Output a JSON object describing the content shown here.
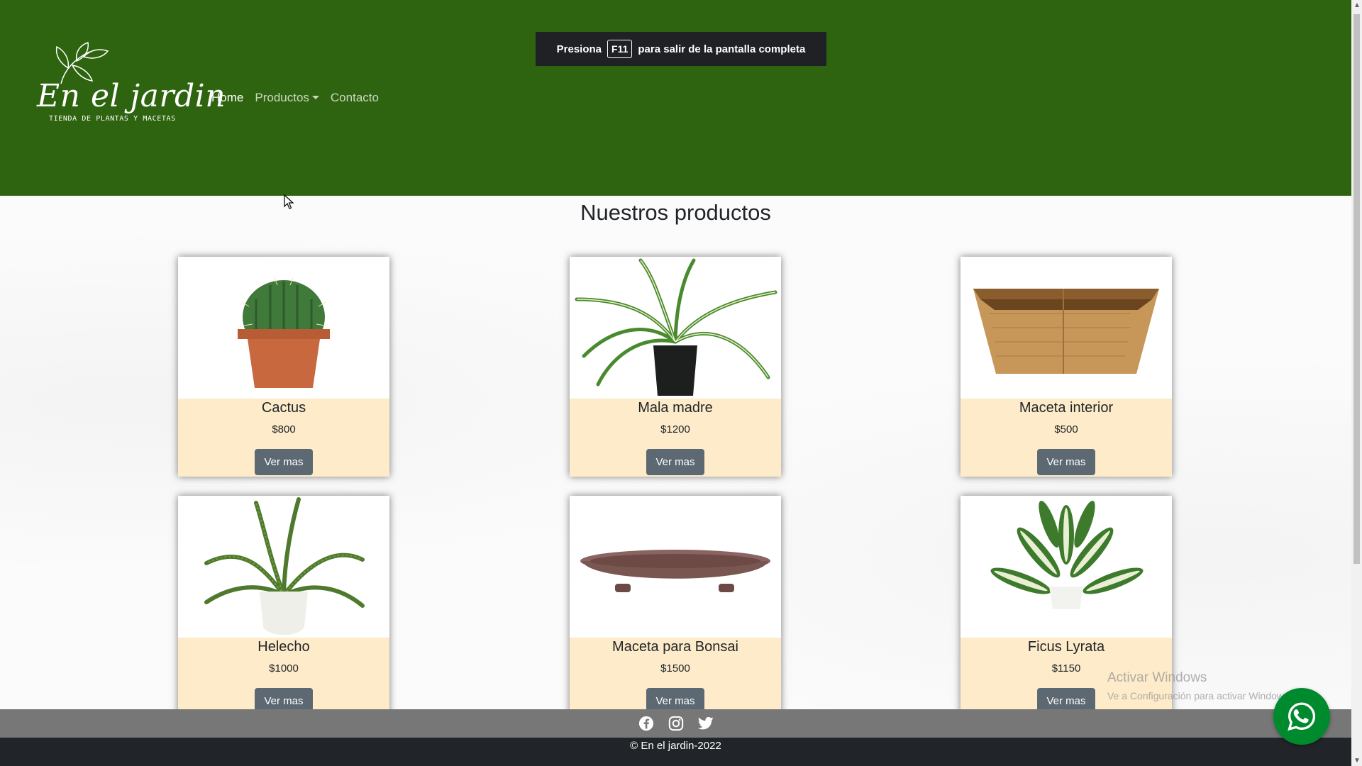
{
  "header": {
    "logo_title": "En el jardin",
    "logo_subtitle": "TIENDA DE PLANTAS Y MACETAS",
    "nav": [
      {
        "label": "Home",
        "active": true
      },
      {
        "label": "Productos",
        "dropdown": true
      },
      {
        "label": "Contacto"
      }
    ],
    "background_color": "#2e6410"
  },
  "fullscreen_notice": {
    "prefix": "Presiona",
    "key": "F11",
    "suffix": "para salir de la pantalla completa"
  },
  "main": {
    "title": "Nuestros productos",
    "products": [
      {
        "name": "Cactus",
        "price": "$800",
        "button": "Ver mas",
        "image": "cactus-image"
      },
      {
        "name": "Mala madre",
        "price": "$1200",
        "button": "Ver mas",
        "image": "spider-plant-image"
      },
      {
        "name": "Maceta interior",
        "price": "$500",
        "button": "Ver mas",
        "image": "wooden-pot-image"
      },
      {
        "name": "Helecho",
        "price": "$1000",
        "button": "Ver mas",
        "image": "fern-image"
      },
      {
        "name": "Maceta para Bonsai",
        "price": "$1500",
        "button": "Ver mas",
        "image": "bonsai-pot-image"
      },
      {
        "name": "Ficus Lyrata",
        "price": "$1150",
        "button": "Ver mas",
        "image": "variegated-plant-image"
      }
    ]
  },
  "watermark": {
    "line1": "Activar Windows",
    "line2": "Ve a Configuración para activar Windows."
  },
  "social": [
    "facebook-icon",
    "instagram-icon",
    "twitter-icon"
  ],
  "footer": {
    "copyright": "© En el jardin-2022"
  },
  "colors": {
    "card_body": "#fdebc9",
    "button": "#5c6872",
    "whatsapp": "#008a2e",
    "footer": "#212529",
    "social_bar": "#777777"
  }
}
